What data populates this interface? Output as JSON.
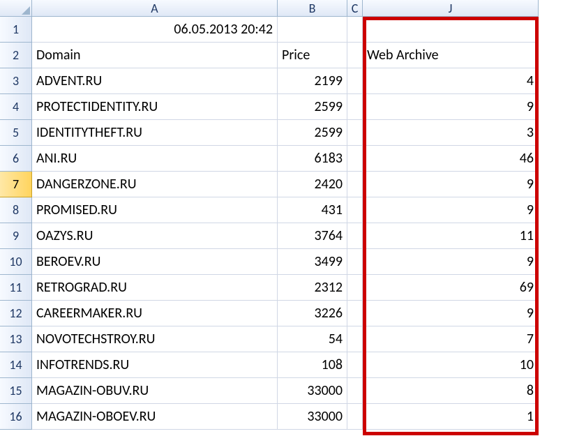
{
  "columns": {
    "A": "A",
    "B": "B",
    "C": "C",
    "J": "J"
  },
  "row1": {
    "A": "06.05.2013 20:42"
  },
  "headers": {
    "domain": "Domain",
    "price": "Price",
    "webarchive": "Web Archive"
  },
  "rows": [
    {
      "n": 3,
      "domain": "ADVENT.RU",
      "price": 2199,
      "wa": 4
    },
    {
      "n": 4,
      "domain": "PROTECTIDENTITY.RU",
      "price": 2599,
      "wa": 9
    },
    {
      "n": 5,
      "domain": "IDENTITYTHEFT.RU",
      "price": 2599,
      "wa": 3
    },
    {
      "n": 6,
      "domain": "ANI.RU",
      "price": 6183,
      "wa": 46
    },
    {
      "n": 7,
      "domain": "DANGERZONE.RU",
      "price": 2420,
      "wa": 9
    },
    {
      "n": 8,
      "domain": "PROMISED.RU",
      "price": 431,
      "wa": 9
    },
    {
      "n": 9,
      "domain": "OAZYS.RU",
      "price": 3764,
      "wa": 11
    },
    {
      "n": 10,
      "domain": "BEROEV.RU",
      "price": 3499,
      "wa": 9
    },
    {
      "n": 11,
      "domain": "RETROGRAD.RU",
      "price": 2312,
      "wa": 69
    },
    {
      "n": 12,
      "domain": "CAREERMAKER.RU",
      "price": 3226,
      "wa": 9
    },
    {
      "n": 13,
      "domain": "NOVOTECHSTROY.RU",
      "price": 54,
      "wa": 7
    },
    {
      "n": 14,
      "domain": "INFOTRENDS.RU",
      "price": 108,
      "wa": 10
    },
    {
      "n": 15,
      "domain": "MAGAZIN-OBUV.RU",
      "price": 33000,
      "wa": 8
    },
    {
      "n": 16,
      "domain": "MAGAZIN-OBOEV.RU",
      "price": 33000,
      "wa": 1
    }
  ],
  "selected_row": 7
}
